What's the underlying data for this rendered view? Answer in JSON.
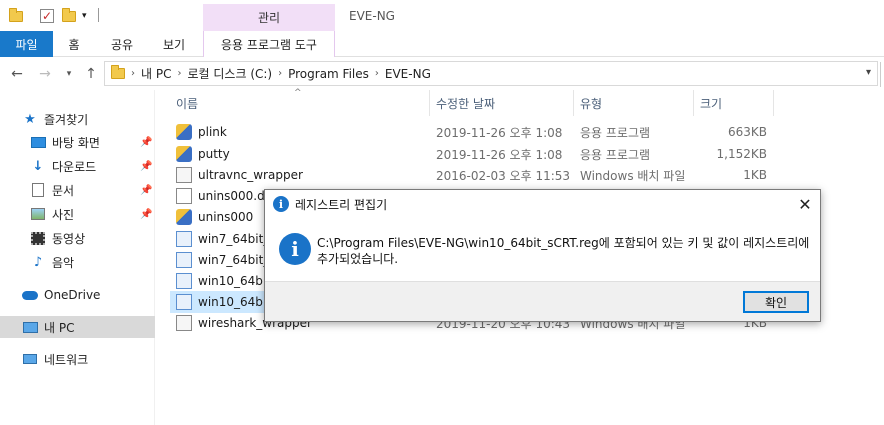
{
  "window": {
    "title": "EVE-NG"
  },
  "ribbon": {
    "context_group": "관리",
    "tabs": [
      "파일",
      "홈",
      "공유",
      "보기",
      "응용 프로그램 도구"
    ]
  },
  "address": {
    "crumbs": [
      "내 PC",
      "로컬 디스크 (C:)",
      "Program Files",
      "EVE-NG"
    ]
  },
  "sidebar": {
    "quick_access": "즐겨찾기",
    "items": [
      {
        "label": "바탕 화면",
        "icon": "desktop-icon",
        "pinned": true
      },
      {
        "label": "다운로드",
        "icon": "download-icon",
        "pinned": true
      },
      {
        "label": "문서",
        "icon": "document-icon",
        "pinned": true
      },
      {
        "label": "사진",
        "icon": "pictures-icon",
        "pinned": true
      },
      {
        "label": "동영상",
        "icon": "video-icon",
        "pinned": false
      },
      {
        "label": "음악",
        "icon": "music-icon",
        "pinned": false
      }
    ],
    "onedrive": "OneDrive",
    "this_pc": "내 PC",
    "network": "네트워크"
  },
  "columns": {
    "name": "이름",
    "date": "수정한 날짜",
    "type": "유형",
    "size": "크기"
  },
  "files": [
    {
      "name": "plink",
      "date": "2019-11-26 오후 1:08",
      "type": "응용 프로그램",
      "size": "663KB",
      "icon": "exe"
    },
    {
      "name": "putty",
      "date": "2019-11-26 오후 1:08",
      "type": "응용 프로그램",
      "size": "1,152KB",
      "icon": "exe"
    },
    {
      "name": "ultravnc_wrapper",
      "date": "2016-02-03 오후 11:53",
      "type": "Windows 배치 파일",
      "size": "1KB",
      "icon": "bat"
    },
    {
      "name": "unins000.dat",
      "date": "",
      "type": "",
      "size": "",
      "icon": "doc"
    },
    {
      "name": "unins000",
      "date": "",
      "type": "",
      "size": "",
      "icon": "exe"
    },
    {
      "name": "win7_64bit_",
      "date": "",
      "type": "",
      "size": "",
      "icon": "reg"
    },
    {
      "name": "win7_64bit_",
      "date": "",
      "type": "",
      "size": "",
      "icon": "reg"
    },
    {
      "name": "win10_64bit_",
      "date": "",
      "type": "",
      "size": "",
      "icon": "reg"
    },
    {
      "name": "win10_64bit_",
      "date": "",
      "type": "",
      "size": "",
      "icon": "reg"
    },
    {
      "name": "wireshark_wrapper",
      "date": "2019-11-20 오후 10:43",
      "type": "Windows 배치 파일",
      "size": "1KB",
      "icon": "bat"
    }
  ],
  "dialog": {
    "title": "레지스트리 편집기",
    "message": "C:\\Program Files\\EVE-NG\\win10_64bit_sCRT.reg에 포함되어 있는 키 및 값이 레지스트리에 추가되었습니다.",
    "ok": "확인"
  }
}
